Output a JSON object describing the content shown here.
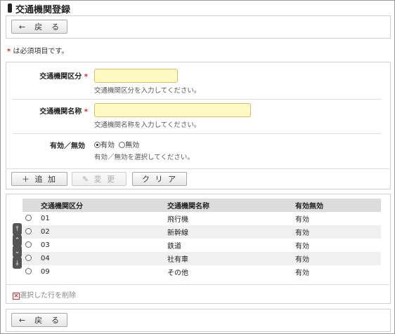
{
  "page": {
    "title": "交通機関登録"
  },
  "top_back_button": "←　戻　る",
  "required_note": {
    "star": "*",
    "text": " は必須項目です。"
  },
  "form": {
    "type": {
      "label": "交通機関区分",
      "required": "*",
      "value": "",
      "hint": "交通機関区分を入力してください。"
    },
    "name": {
      "label": "交通機関名称",
      "required": "*",
      "value": "",
      "hint": "交通機関名称を入力してください。"
    },
    "active": {
      "label": "有効／無効",
      "options": [
        "有効",
        "無効"
      ],
      "selected": "有効",
      "hint": "有効／無効を選択してください。"
    }
  },
  "actions": {
    "add": "＋ 追 加",
    "change": "✎ 変 更",
    "clear": "ク リ ア"
  },
  "table": {
    "headers": [
      "交通機関区分",
      "交通機関名称",
      "有効無効"
    ],
    "rows": [
      {
        "code": "01",
        "name": "飛行機",
        "status": "有効"
      },
      {
        "code": "02",
        "name": "新幹線",
        "status": "有効"
      },
      {
        "code": "03",
        "name": "鉄道",
        "status": "有効"
      },
      {
        "code": "04",
        "name": "社有車",
        "status": "有効"
      },
      {
        "code": "09",
        "name": "その他",
        "status": "有効"
      }
    ]
  },
  "delete_selected": "選択した行を削除",
  "bottom_back_button": "←　戻　る",
  "colors": {
    "required": "#dd2222",
    "input_bg": "#fff9c4",
    "input_border": "#e0b860",
    "header_bg": "#dcdcdc"
  }
}
